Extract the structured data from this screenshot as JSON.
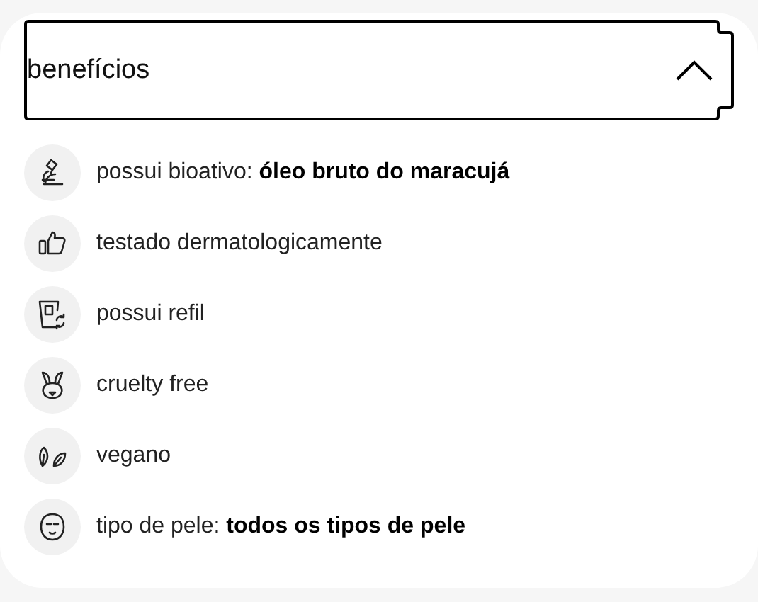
{
  "accordion": {
    "title": "benefícios",
    "expanded": true
  },
  "benefits": [
    {
      "kind": "microscope",
      "text": "possui bioativo: **óleo bruto do maracujá**"
    },
    {
      "kind": "thumbsup",
      "text": "testado dermatologicamente"
    },
    {
      "kind": "refill",
      "text": "possui refil"
    },
    {
      "kind": "rabbit",
      "text": "cruelty free"
    },
    {
      "kind": "leaves",
      "text": "vegano"
    },
    {
      "kind": "face",
      "text": "tipo de pele: **todos os tipos de pele**"
    }
  ]
}
